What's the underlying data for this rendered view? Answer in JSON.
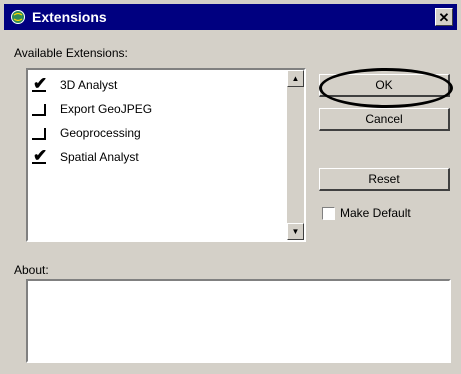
{
  "window": {
    "title": "Extensions",
    "close_glyph": "✕"
  },
  "available_label": "Available Extensions:",
  "extensions": [
    {
      "label": "3D Analyst",
      "checked": true
    },
    {
      "label": "Export GeoJPEG",
      "checked": false
    },
    {
      "label": "Geoprocessing",
      "checked": false
    },
    {
      "label": "Spatial Analyst",
      "checked": true
    }
  ],
  "buttons": {
    "ok": "OK",
    "cancel": "Cancel",
    "reset": "Reset"
  },
  "make_default": {
    "label": "Make Default",
    "checked": false
  },
  "about_label": "About:",
  "icons": {
    "check": "✔",
    "scroll_up": "▲",
    "scroll_down": "▼"
  },
  "colors": {
    "titlebar": "#000080",
    "face": "#d4d0c8"
  }
}
